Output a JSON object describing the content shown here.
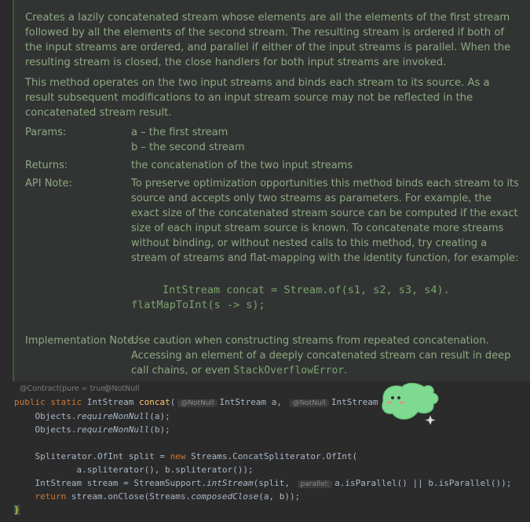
{
  "doc": {
    "para1": "Creates a lazily concatenated stream whose elements are all the elements of the first stream followed by all the elements of the second stream. The resulting stream is ordered if both of the input streams are ordered, and parallel if either of the input streams is parallel. When the resulting stream is closed, the close handlers for both input streams are invoked.",
    "para2": "This method operates on the two input streams and binds each stream to its source. As a result subsequent modifications to an input stream source may not be reflected in the concatenated stream result.",
    "params_label": "Params:",
    "param_a": "a – the first stream",
    "param_b": "b – the second stream",
    "returns_label": "Returns:",
    "returns_value": "the concatenation of the two input streams",
    "api_label": "API Note:",
    "api_value": "To preserve optimization opportunities this method binds each stream to its source and accepts only two streams as parameters. For example, the exact size of the concatenated stream source can be computed if the exact size of each input stream source is known. To concatenate more streams without binding, or without nested calls to this method, try creating a stream of streams and flat-mapping with the identity function, for example:",
    "api_code_1": "IntStream concat = Stream.of(s1, s2, s3, s4).",
    "api_code_2": "flatMapToInt(s -> s);",
    "impl_label": "Implementation Note:",
    "impl_value": "Use caution when constructing streams from repeated concatenation. Accessing an element of a deeply concatenated stream can result in deep call chains, or even",
    "impl_code": "StackOverflowError",
    "impl_end": "."
  },
  "annotations": {
    "contract": "@Contract(pure = true)",
    "notnull": "@NotNull"
  },
  "code": {
    "sig_public": "public static",
    "sig_type": " IntStream ",
    "sig_name": "concat",
    "sig_paren": "(",
    "hint_notnull_a": "@NotNull",
    "sig_param_a": "IntStream a,",
    "hint_notnull_b": "@NotNull",
    "sig_param_b": "IntStream b) ",
    "sig_brace": "{",
    "l2": "    Objects.",
    "l2_m": "requireNonNull",
    "l2_e": "(a);",
    "l3": "    Objects.",
    "l3_m": "requireNonNull",
    "l3_e": "(b);",
    "l5_a": "    Spliterator.OfInt split = ",
    "l5_new": "new",
    "l5_b": " Streams.ConcatSpliterator.OfInt(",
    "l6": "            a.spliterator(), b.spliterator());",
    "l7_a": "    IntStream stream = StreamSupport.",
    "l7_m": "intStream",
    "l7_b": "(split, ",
    "hint_parallel": "parallel:",
    "l7_c": "a.isParallel() || b.isParallel());",
    "l8_ret": "    return",
    "l8_a": " stream.onClose(Streams.",
    "l8_m": "composedClose",
    "l8_b": "(a, b));",
    "l9": "}"
  }
}
